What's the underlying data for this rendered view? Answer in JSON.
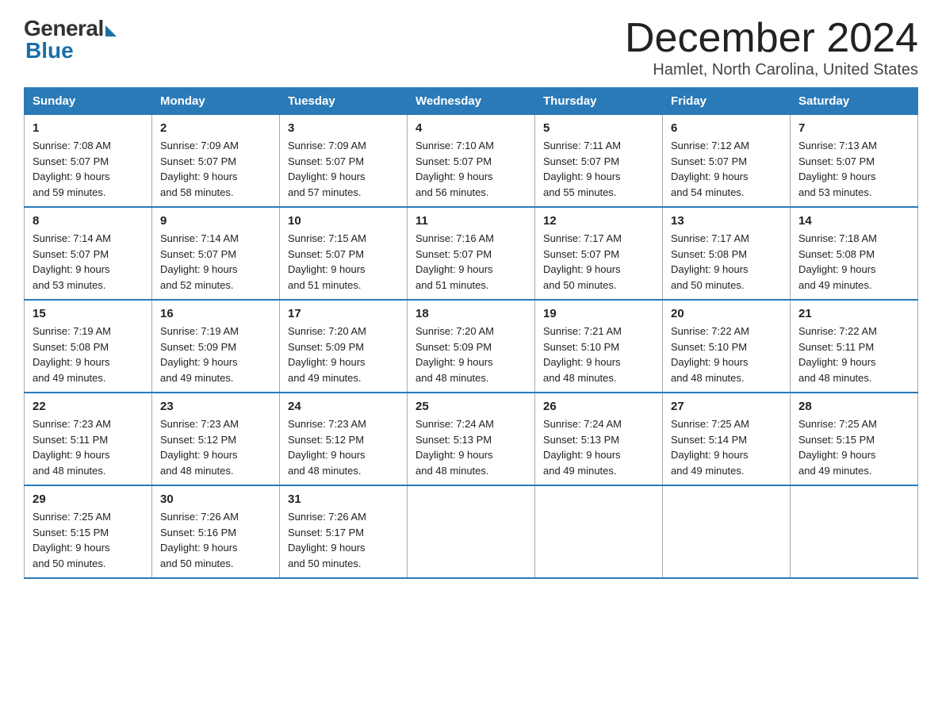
{
  "logo": {
    "general": "General",
    "blue": "Blue"
  },
  "title": {
    "month": "December 2024",
    "location": "Hamlet, North Carolina, United States"
  },
  "days_of_week": [
    "Sunday",
    "Monday",
    "Tuesday",
    "Wednesday",
    "Thursday",
    "Friday",
    "Saturday"
  ],
  "weeks": [
    [
      {
        "day": "1",
        "sunrise": "7:08 AM",
        "sunset": "5:07 PM",
        "daylight": "9 hours and 59 minutes."
      },
      {
        "day": "2",
        "sunrise": "7:09 AM",
        "sunset": "5:07 PM",
        "daylight": "9 hours and 58 minutes."
      },
      {
        "day": "3",
        "sunrise": "7:09 AM",
        "sunset": "5:07 PM",
        "daylight": "9 hours and 57 minutes."
      },
      {
        "day": "4",
        "sunrise": "7:10 AM",
        "sunset": "5:07 PM",
        "daylight": "9 hours and 56 minutes."
      },
      {
        "day": "5",
        "sunrise": "7:11 AM",
        "sunset": "5:07 PM",
        "daylight": "9 hours and 55 minutes."
      },
      {
        "day": "6",
        "sunrise": "7:12 AM",
        "sunset": "5:07 PM",
        "daylight": "9 hours and 54 minutes."
      },
      {
        "day": "7",
        "sunrise": "7:13 AM",
        "sunset": "5:07 PM",
        "daylight": "9 hours and 53 minutes."
      }
    ],
    [
      {
        "day": "8",
        "sunrise": "7:14 AM",
        "sunset": "5:07 PM",
        "daylight": "9 hours and 53 minutes."
      },
      {
        "day": "9",
        "sunrise": "7:14 AM",
        "sunset": "5:07 PM",
        "daylight": "9 hours and 52 minutes."
      },
      {
        "day": "10",
        "sunrise": "7:15 AM",
        "sunset": "5:07 PM",
        "daylight": "9 hours and 51 minutes."
      },
      {
        "day": "11",
        "sunrise": "7:16 AM",
        "sunset": "5:07 PM",
        "daylight": "9 hours and 51 minutes."
      },
      {
        "day": "12",
        "sunrise": "7:17 AM",
        "sunset": "5:07 PM",
        "daylight": "9 hours and 50 minutes."
      },
      {
        "day": "13",
        "sunrise": "7:17 AM",
        "sunset": "5:08 PM",
        "daylight": "9 hours and 50 minutes."
      },
      {
        "day": "14",
        "sunrise": "7:18 AM",
        "sunset": "5:08 PM",
        "daylight": "9 hours and 49 minutes."
      }
    ],
    [
      {
        "day": "15",
        "sunrise": "7:19 AM",
        "sunset": "5:08 PM",
        "daylight": "9 hours and 49 minutes."
      },
      {
        "day": "16",
        "sunrise": "7:19 AM",
        "sunset": "5:09 PM",
        "daylight": "9 hours and 49 minutes."
      },
      {
        "day": "17",
        "sunrise": "7:20 AM",
        "sunset": "5:09 PM",
        "daylight": "9 hours and 49 minutes."
      },
      {
        "day": "18",
        "sunrise": "7:20 AM",
        "sunset": "5:09 PM",
        "daylight": "9 hours and 48 minutes."
      },
      {
        "day": "19",
        "sunrise": "7:21 AM",
        "sunset": "5:10 PM",
        "daylight": "9 hours and 48 minutes."
      },
      {
        "day": "20",
        "sunrise": "7:22 AM",
        "sunset": "5:10 PM",
        "daylight": "9 hours and 48 minutes."
      },
      {
        "day": "21",
        "sunrise": "7:22 AM",
        "sunset": "5:11 PM",
        "daylight": "9 hours and 48 minutes."
      }
    ],
    [
      {
        "day": "22",
        "sunrise": "7:23 AM",
        "sunset": "5:11 PM",
        "daylight": "9 hours and 48 minutes."
      },
      {
        "day": "23",
        "sunrise": "7:23 AM",
        "sunset": "5:12 PM",
        "daylight": "9 hours and 48 minutes."
      },
      {
        "day": "24",
        "sunrise": "7:23 AM",
        "sunset": "5:12 PM",
        "daylight": "9 hours and 48 minutes."
      },
      {
        "day": "25",
        "sunrise": "7:24 AM",
        "sunset": "5:13 PM",
        "daylight": "9 hours and 48 minutes."
      },
      {
        "day": "26",
        "sunrise": "7:24 AM",
        "sunset": "5:13 PM",
        "daylight": "9 hours and 49 minutes."
      },
      {
        "day": "27",
        "sunrise": "7:25 AM",
        "sunset": "5:14 PM",
        "daylight": "9 hours and 49 minutes."
      },
      {
        "day": "28",
        "sunrise": "7:25 AM",
        "sunset": "5:15 PM",
        "daylight": "9 hours and 49 minutes."
      }
    ],
    [
      {
        "day": "29",
        "sunrise": "7:25 AM",
        "sunset": "5:15 PM",
        "daylight": "9 hours and 50 minutes."
      },
      {
        "day": "30",
        "sunrise": "7:26 AM",
        "sunset": "5:16 PM",
        "daylight": "9 hours and 50 minutes."
      },
      {
        "day": "31",
        "sunrise": "7:26 AM",
        "sunset": "5:17 PM",
        "daylight": "9 hours and 50 minutes."
      },
      null,
      null,
      null,
      null
    ]
  ],
  "labels": {
    "sunrise": "Sunrise: ",
    "sunset": "Sunset: ",
    "daylight": "Daylight: "
  }
}
